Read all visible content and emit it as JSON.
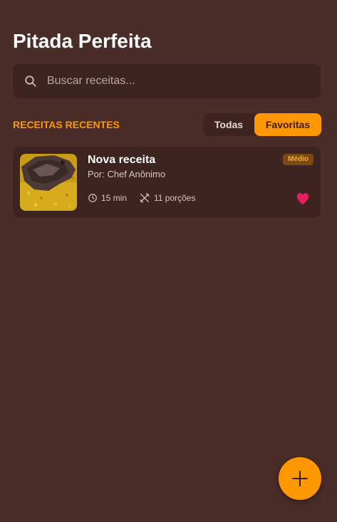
{
  "app": {
    "title": "Pitada Perfeita"
  },
  "search": {
    "placeholder": "Buscar receitas...",
    "value": "",
    "icon": "search-icon"
  },
  "section": {
    "title": "RECEITAS RECENTES"
  },
  "filters": {
    "all_label": "Todas",
    "favorites_label": "Favoritas",
    "active": "Favoritas"
  },
  "recipes": [
    {
      "name": "Nova receita",
      "author": "Por: Chef Anônimo",
      "difficulty": "Médio",
      "time": "15 min",
      "servings": "11 porções",
      "favorite": true,
      "time_icon": "clock-icon",
      "servings_icon": "utensils-icon",
      "favorite_icon": "heart-icon"
    }
  ],
  "fab": {
    "icon": "plus-icon"
  },
  "colors": {
    "background": "#4a2c28",
    "surface": "#3d2420",
    "accent": "#ff9800",
    "favorite": "#e91e63",
    "badge_bg": "#7a4a10",
    "badge_text": "#ffa726"
  }
}
